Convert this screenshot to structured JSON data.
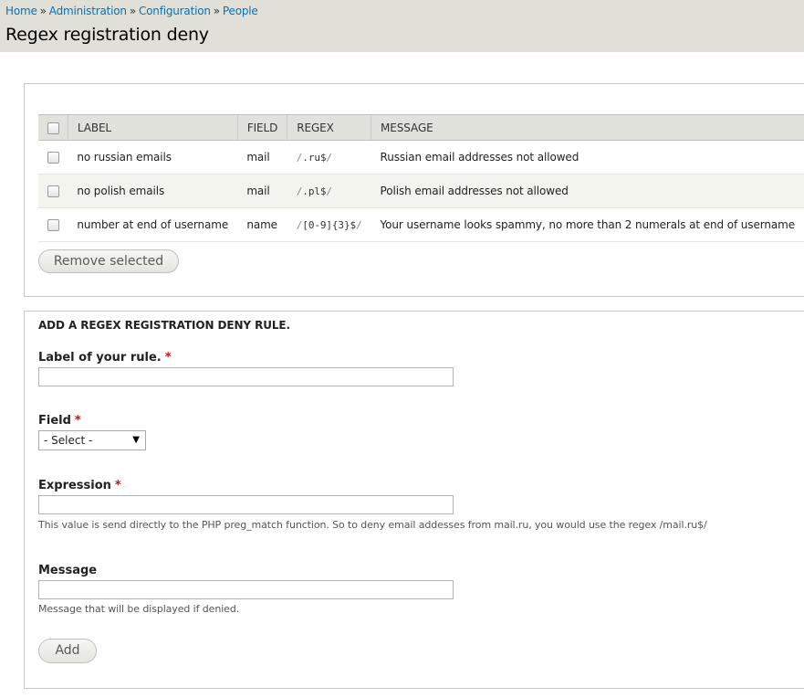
{
  "breadcrumb": {
    "items": [
      "Home",
      "Administration",
      "Configuration",
      "People"
    ],
    "separator": "»"
  },
  "page": {
    "title": "Regex registration deny"
  },
  "rules_table": {
    "headers": [
      "LABEL",
      "FIELD",
      "REGEX",
      "MESSAGE"
    ],
    "rows": [
      {
        "label": "no russian emails",
        "field": "mail",
        "regex": ".ru$",
        "message": "Russian email addresses not allowed"
      },
      {
        "label": "no polish emails",
        "field": "mail",
        "regex": ".pl$",
        "message": "Polish email addresses not allowed"
      },
      {
        "label": "number at end of username",
        "field": "name",
        "regex": "[0-9]{3}$",
        "message": "Your username looks spammy, no more than 2 numerals at end of username"
      }
    ],
    "remove_button": "Remove selected"
  },
  "add_form": {
    "legend": "ADD A REGEX REGISTRATION DENY RULE.",
    "label_field": {
      "label": "Label of your rule.",
      "required_marker": "*",
      "value": ""
    },
    "field_select": {
      "label": "Field",
      "required_marker": "*",
      "selected": "- Select -"
    },
    "expression_field": {
      "label": "Expression",
      "required_marker": "*",
      "value": "",
      "description": "This value is send directly to the PHP preg_match function. So to deny email addesses from mail.ru, you would use the regex /mail.ru$/"
    },
    "message_field": {
      "label": "Message",
      "value": "",
      "description": "Message that will be displayed if denied."
    },
    "add_button": "Add"
  },
  "regex_delimiter": "/",
  "icons": {
    "select_arrow": "triangle-down-icon"
  },
  "colors": {
    "link": "#0074bd",
    "required": "#ee0000",
    "header_bg": "#e0e0d8"
  }
}
